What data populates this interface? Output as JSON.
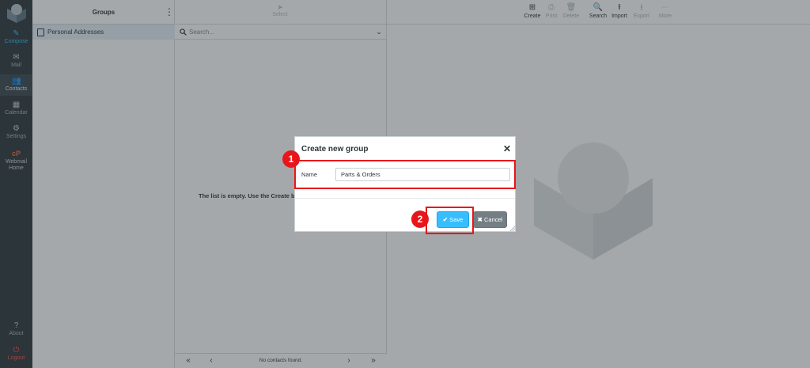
{
  "nav": {
    "items": [
      {
        "label": "Compose",
        "icon": "compose-icon"
      },
      {
        "label": "Mail",
        "icon": "mail-icon"
      },
      {
        "label": "Contacts",
        "icon": "contacts-icon"
      },
      {
        "label": "Calendar",
        "icon": "calendar-icon"
      },
      {
        "label": "Settings",
        "icon": "gear-icon"
      },
      {
        "label": "Webmail Home",
        "icon": "cpanel-icon"
      },
      {
        "label": "About",
        "icon": "question-icon"
      },
      {
        "label": "Logout",
        "icon": "power-icon"
      }
    ],
    "active": "Contacts"
  },
  "groups": {
    "title": "Groups",
    "address_book": "Personal Addresses"
  },
  "contacts": {
    "select_label": "Select",
    "search_placeholder": "Search...",
    "empty_message": "The list is empty. Use the Create bu",
    "footer_status": "No contacts found."
  },
  "toolbar": {
    "create": "Create",
    "print": "Print",
    "delete": "Delete",
    "search": "Search",
    "import": "Import",
    "export": "Export",
    "more": "More"
  },
  "dialog": {
    "title": "Create new group",
    "name_label": "Name",
    "name_value": "Parts & Orders",
    "save_label": "Save",
    "cancel_label": "Cancel"
  },
  "annotations": {
    "step1": "1",
    "step2": "2"
  },
  "colors": {
    "accent": "#37beff",
    "sidebar": "#2f3a3f",
    "highlight": "#e8161b",
    "logout": "#ff5552"
  }
}
